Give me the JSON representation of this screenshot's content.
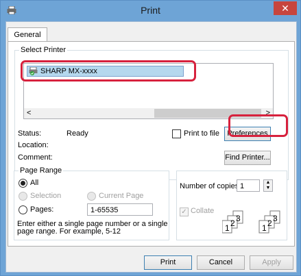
{
  "window": {
    "title": "Print",
    "close_glyph": "✕",
    "icon": "printer-icon"
  },
  "tabs": [
    {
      "label": "General"
    }
  ],
  "select_printer": {
    "legend": "Select Printer",
    "printers": [
      {
        "name": "SHARP MX-xxxx",
        "selected": true,
        "icon": "printer-ok-icon"
      }
    ],
    "scroll_left": "<",
    "scroll_right": ">"
  },
  "printer_info": {
    "status_label": "Status:",
    "status_value": "Ready",
    "location_label": "Location:",
    "comment_label": "Comment:"
  },
  "print_to_file": {
    "label": "Print to file",
    "checked": false
  },
  "buttons": {
    "preferences": "Preferences",
    "find_printer": "Find Printer...",
    "print": "Print",
    "cancel": "Cancel",
    "apply": "Apply"
  },
  "page_range": {
    "legend": "Page Range",
    "all": "All",
    "selection": "Selection",
    "current_page": "Current Page",
    "pages": "Pages:",
    "pages_value": "1-65535",
    "hint_line1": "Enter either a single page number or a single",
    "hint_line2": "page range.  For example, 5-12"
  },
  "copies": {
    "label": "Number of copies:",
    "value": "1",
    "collate_label": "Collate",
    "collate_checked": true,
    "collate_page_numbers": [
      "1",
      "2",
      "3"
    ]
  },
  "highlight_color": "#d7213d"
}
